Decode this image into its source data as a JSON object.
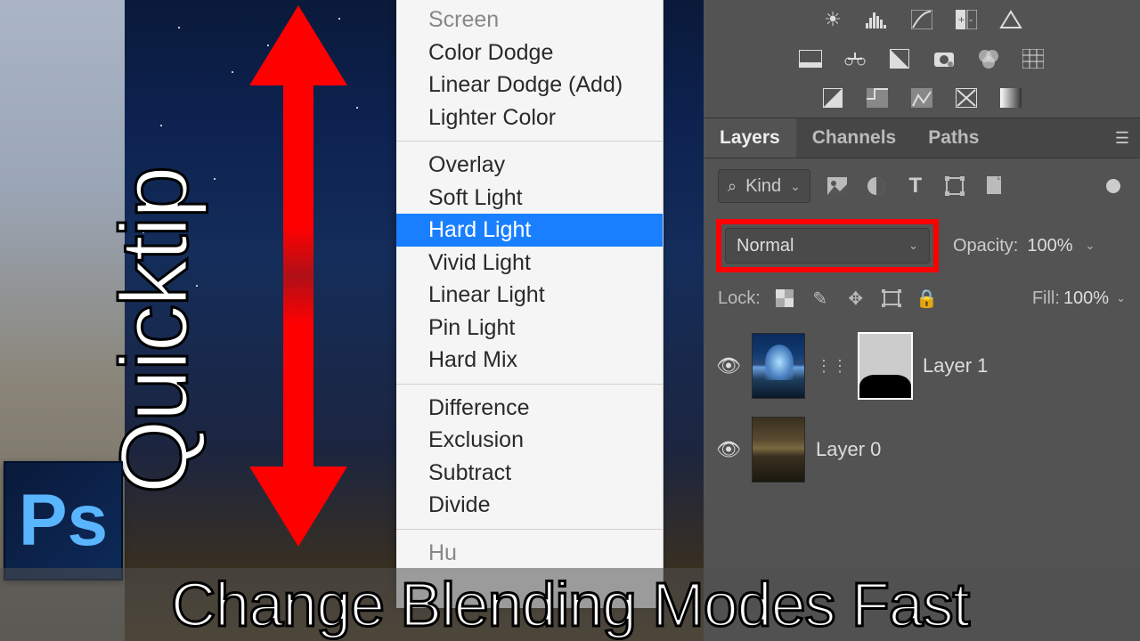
{
  "title_side": "Quicktip",
  "caption": "Change Blending Modes Fast",
  "ps_logo": "Ps",
  "menu": {
    "group1": [
      {
        "label": "Screen",
        "faded": true
      },
      {
        "label": "Color Dodge"
      },
      {
        "label": "Linear Dodge (Add)"
      },
      {
        "label": "Lighter Color"
      }
    ],
    "group2": [
      {
        "label": "Overlay"
      },
      {
        "label": "Soft Light"
      },
      {
        "label": "Hard Light",
        "selected": true
      },
      {
        "label": "Vivid Light"
      },
      {
        "label": "Linear Light"
      },
      {
        "label": "Pin Light"
      },
      {
        "label": "Hard Mix"
      }
    ],
    "group3": [
      {
        "label": "Difference"
      },
      {
        "label": "Exclusion"
      },
      {
        "label": "Subtract"
      },
      {
        "label": "Divide"
      }
    ],
    "group4": [
      {
        "label": "Hu",
        "faded": true
      }
    ]
  },
  "panel": {
    "tabs": [
      "Layers",
      "Channels",
      "Paths"
    ],
    "active_tab": 0,
    "filter_label": "Kind",
    "blend_mode": "Normal",
    "opacity_label": "Opacity:",
    "opacity_value": "100%",
    "lock_label": "Lock:",
    "fill_label": "Fill:",
    "fill_value": "100%",
    "layers": [
      {
        "name": "Layer 1",
        "has_mask": true
      },
      {
        "name": "Layer 0",
        "has_mask": false
      }
    ]
  },
  "icons": {
    "brightness": "brightness-icon",
    "levels": "levels-icon",
    "curves": "curves-icon",
    "exposure": "exposure-icon",
    "triangle": "vibrance-icon",
    "photo": "photo-filter-icon",
    "balance": "color-balance-icon",
    "bw": "bw-icon",
    "camera": "channel-mixer-icon",
    "lookup": "color-lookup-icon",
    "grid": "posterize-icon",
    "invert": "invert-icon",
    "threshold": "threshold-icon",
    "selective": "selective-color-icon",
    "gradient": "gradient-map-icon",
    "solid": "solid-icon"
  }
}
